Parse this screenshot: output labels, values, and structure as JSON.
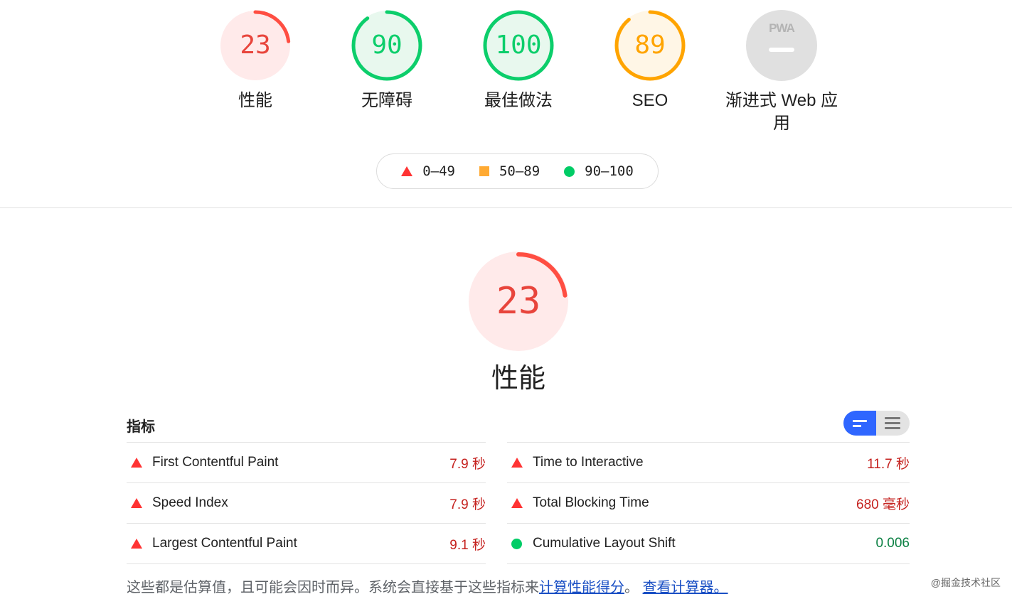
{
  "categories": [
    {
      "score": "23",
      "label": "性能",
      "fraction": 0.23,
      "color": "#ff4e42",
      "fill": "#ffeaea",
      "textColor": "#e8453c"
    },
    {
      "score": "90",
      "label": "无障碍",
      "fraction": 0.9,
      "color": "#0cce6b",
      "fill": "#e8f8ee",
      "textColor": "#0cce6b"
    },
    {
      "score": "100",
      "label": "最佳做法",
      "fraction": 1.0,
      "color": "#0cce6b",
      "fill": "#e8f8ee",
      "textColor": "#0cce6b"
    },
    {
      "score": "89",
      "label": "SEO",
      "fraction": 0.89,
      "color": "#ffa400",
      "fill": "#fff6e6",
      "textColor": "#ffa400"
    },
    {
      "score": "PWA",
      "label": "渐进式 Web 应用",
      "fraction": 0,
      "color": "#dddddd",
      "fill": "#e0e0e0",
      "textColor": "#b4b4b4"
    }
  ],
  "legend": {
    "fail": "0–49",
    "average": "50–89",
    "pass": "90–100"
  },
  "perf": {
    "score": "23",
    "fraction": 0.23,
    "title": "性能"
  },
  "metrics_title": "指标",
  "metrics": {
    "left": [
      {
        "name": "First Contentful Paint",
        "value": "7.9 秒",
        "status": "fail"
      },
      {
        "name": "Speed Index",
        "value": "7.9 秒",
        "status": "fail"
      },
      {
        "name": "Largest Contentful Paint",
        "value": "9.1 秒",
        "status": "fail"
      }
    ],
    "right": [
      {
        "name": "Time to Interactive",
        "value": "11.7 秒",
        "status": "fail"
      },
      {
        "name": "Total Blocking Time",
        "value": "680 毫秒",
        "status": "fail"
      },
      {
        "name": "Cumulative Layout Shift",
        "value": "0.006",
        "status": "pass"
      }
    ]
  },
  "footnote": {
    "text": "这些都是估算值，且可能会因时而异。系统会直接基于这些指标来",
    "link1": "计算性能得分",
    "sep": "。",
    "link2": "查看计算器。"
  },
  "watermark": "@掘金技术社区",
  "colors": {
    "fail": "#ff4e42",
    "average": "#ffa400",
    "pass": "#0cce6b"
  }
}
